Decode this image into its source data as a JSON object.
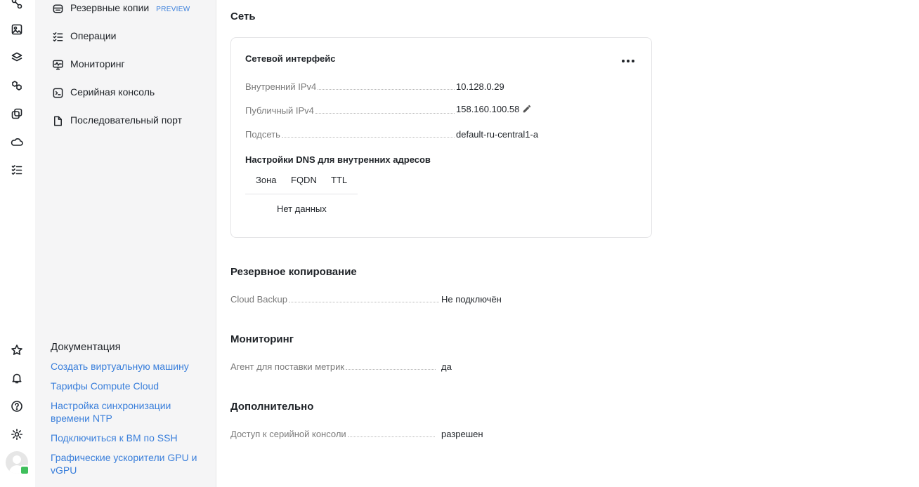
{
  "rail": {
    "top_icons": [
      "graph-icon",
      "image-icon",
      "layers-icon",
      "hexagons-icon",
      "copy-icon",
      "cloud-disk-icon",
      "checklist-icon"
    ],
    "bottom_icons": [
      "star-icon",
      "bell-icon",
      "help-icon",
      "settings-icon"
    ]
  },
  "sidebar": {
    "items": [
      {
        "label": "Резервные копии",
        "badge": "PREVIEW",
        "icon": "backup-icon"
      },
      {
        "label": "Операции",
        "icon": "checklist-icon"
      },
      {
        "label": "Мониторинг",
        "icon": "monitoring-icon"
      },
      {
        "label": "Серийная консоль",
        "icon": "terminal-icon"
      },
      {
        "label": "Последовательный порт",
        "icon": "file-icon"
      }
    ],
    "docs": {
      "title": "Документация",
      "links": [
        "Создать виртуальную машину",
        "Тарифы Compute Cloud",
        "Настройка синхронизации времени NTP",
        "Подключиться к ВМ по SSH",
        "Графические ускорители GPU и vGPU"
      ]
    }
  },
  "main": {
    "network": {
      "title": "Сеть",
      "card_title": "Сетевой интерфейс",
      "rows": [
        {
          "key": "Внутренний IPv4",
          "value": "10.128.0.29"
        },
        {
          "key": "Публичный IPv4",
          "value": "158.160.100.58"
        },
        {
          "key": "Подсеть",
          "value": "default-ru-central1-a"
        }
      ],
      "dns": {
        "title": "Настройки DNS для внутренних адресов",
        "columns": [
          "Зона",
          "FQDN",
          "TTL"
        ],
        "empty": "Нет данных"
      }
    },
    "backup": {
      "title": "Резервное копирование",
      "key": "Cloud Backup",
      "value": "Не подключён"
    },
    "monitoring": {
      "title": "Мониторинг",
      "key": "Агент для поставки метрик",
      "value": "да"
    },
    "extra": {
      "title": "Дополнительно",
      "key": "Доступ к серийной консоли",
      "value": "разрешен"
    }
  },
  "colors": {
    "link": "#3a7fdb",
    "success": "#2c9a2c",
    "sidebar_bg": "#f5f5f6"
  }
}
